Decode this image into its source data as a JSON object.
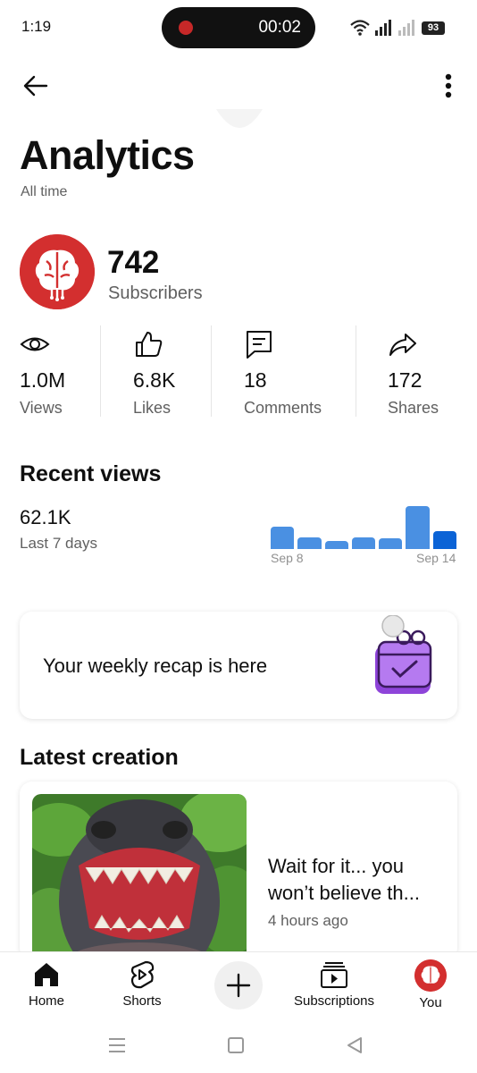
{
  "status_bar": {
    "time": "1:19",
    "recording_time": "00:02",
    "battery": "93"
  },
  "header": {
    "title": "Analytics",
    "subtitle": "All time"
  },
  "channel": {
    "subscriber_count": "742",
    "subscriber_label": "Subscribers",
    "avatar_color": "#d32f2f"
  },
  "stats": [
    {
      "value": "1.0M",
      "label": "Views",
      "icon": "eye-icon"
    },
    {
      "value": "6.8K",
      "label": "Likes",
      "icon": "thumbs-up-icon"
    },
    {
      "value": "18",
      "label": "Comments",
      "icon": "comment-icon"
    },
    {
      "value": "172",
      "label": "Shares",
      "icon": "share-icon"
    }
  ],
  "recent_views": {
    "title": "Recent views",
    "value": "62.1K",
    "period": "Last 7 days",
    "start_label": "Sep 8",
    "end_label": "Sep 14",
    "chart_data": {
      "type": "bar",
      "categories": [
        "Sep 8",
        "Sep 9",
        "Sep 10",
        "Sep 11",
        "Sep 12",
        "Sep 13",
        "Sep 14"
      ],
      "values": [
        0.52,
        0.27,
        0.18,
        0.27,
        0.24,
        1.0,
        0.41
      ],
      "highlight_index": 6,
      "colors": {
        "bar": "#4a90e2",
        "highlight": "#0b63d6"
      }
    }
  },
  "recap": {
    "text": "Your weekly recap is here",
    "accent": "#8e44d9"
  },
  "latest_creation": {
    "section_title": "Latest creation",
    "video_title": "Wait for it... you won’t believe th...",
    "posted": "4 hours ago"
  },
  "bottom_nav": {
    "items": [
      {
        "label": "Home",
        "icon": "home-icon"
      },
      {
        "label": "Shorts",
        "icon": "shorts-icon"
      },
      {
        "label": "",
        "icon": "plus-icon"
      },
      {
        "label": "Subscriptions",
        "icon": "subscriptions-icon"
      },
      {
        "label": "You",
        "icon": "avatar"
      }
    ]
  }
}
